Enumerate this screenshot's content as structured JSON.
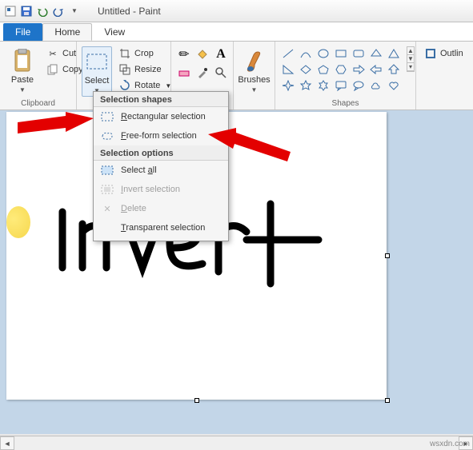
{
  "titlebar": {
    "title": "Untitled - Paint"
  },
  "tabs": {
    "file": "File",
    "home": "Home",
    "view": "View"
  },
  "ribbon": {
    "clipboard": {
      "label": "Clipboard",
      "paste": "Paste",
      "cut": "Cut",
      "copy": "Copy"
    },
    "image": {
      "select": "Select",
      "crop": "Crop",
      "resize": "Resize",
      "rotate": "Rotate"
    },
    "tools": {
      "label": ""
    },
    "brushes": {
      "label": "Brushes"
    },
    "shapes": {
      "label": "Shapes"
    },
    "size": {
      "outline": "Outlin"
    }
  },
  "dropdown": {
    "shapes_header": "Selection shapes",
    "rect": "ectangular selection",
    "rect_key": "R",
    "free": "ree-form selection",
    "free_key": "F",
    "options_header": "Selection options",
    "selectall": "Select ",
    "selectall_key": "a",
    "selectall_suffix": "ll",
    "invert": "nvert selection",
    "invert_key": "I",
    "delete": "elete",
    "delete_key": "D",
    "transparent": "ransparent selection",
    "transparent_key": "T"
  },
  "canvas_text": "Invert",
  "watermark": "wsxdn.com"
}
